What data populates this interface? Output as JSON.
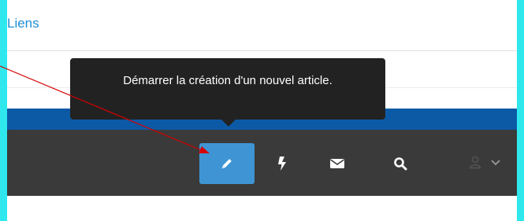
{
  "header": {
    "links_label": "Liens"
  },
  "tooltip": {
    "text": "Démarrer la création d'un nouvel article."
  },
  "toolbar": {
    "items": [
      {
        "icon": "pencil-icon",
        "active": true
      },
      {
        "icon": "lightning-icon",
        "active": false
      },
      {
        "icon": "envelope-icon",
        "active": false
      },
      {
        "icon": "search-icon",
        "active": false
      },
      {
        "icon": "user-icon",
        "active": false
      },
      {
        "icon": "chevron-down-icon",
        "active": false
      }
    ]
  },
  "colors": {
    "frame": "#2ee8ee",
    "link": "#1f8fd6",
    "blue_strip": "#0c5aa6",
    "toolbar": "#3a3a3a",
    "active_button": "#3f95d4",
    "tooltip": "#222222",
    "annotation_arrow": "#d40000"
  }
}
